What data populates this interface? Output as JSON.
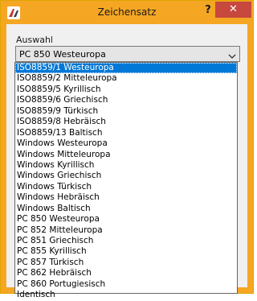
{
  "window": {
    "title": "Zeichensatz",
    "help_label": "?",
    "close_label": "✕",
    "accent_color": "#f5a623",
    "close_color": "#c7483d",
    "icon": "app-logo-icon"
  },
  "group": {
    "label": "Auswahl"
  },
  "combo": {
    "value": "PC 850 Westeuropa"
  },
  "dropdown": {
    "selected_index": 0,
    "options": [
      "ISO8859/1 Westeuropa",
      "ISO8859/2 Mitteleuropa",
      "ISO8859/5 Kyrillisch",
      "ISO8859/6 Griechisch",
      "ISO8859/9 Türkisch",
      "ISO8859/8 Hebräisch",
      "ISO8859/13 Baltisch",
      "Windows Westeuropa",
      "Windows Mitteleuropa",
      "Windows Kyrillisch",
      "Windows Griechisch",
      "Windows Türkisch",
      "Windows Hebräisch",
      "Windows Baltisch",
      "PC 850 Westeuropa",
      "PC 852 Mitteleuropa",
      "PC 851 Griechisch",
      "PC 855 Kyrillisch",
      "PC 857 Türkisch",
      "PC 862 Hebräisch",
      "PC 860 Portugiesisch",
      "Identisch"
    ]
  }
}
